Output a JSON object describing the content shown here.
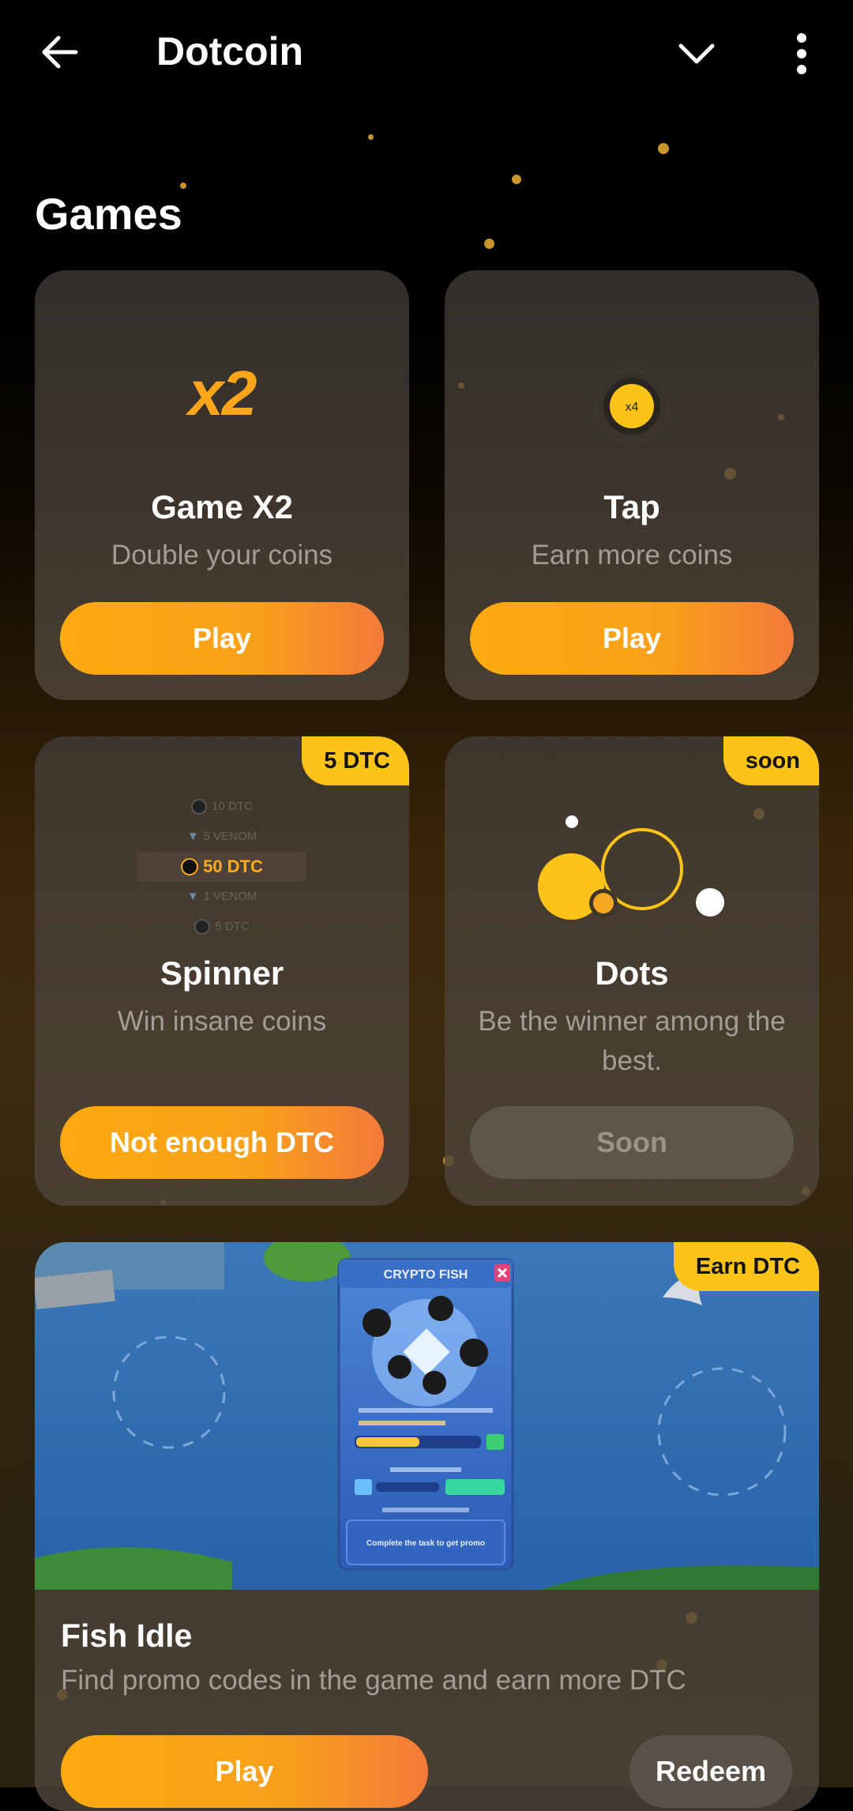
{
  "header": {
    "title": "Dotcoin"
  },
  "section": {
    "title": "Games"
  },
  "cards": [
    {
      "logo": "x2",
      "title": "Game X2",
      "subtitle": "Double your coins",
      "button": "Play"
    },
    {
      "logo": "x4",
      "title": "Tap",
      "subtitle": "Earn more coins",
      "button": "Play"
    },
    {
      "badge": "5 DTC",
      "title": "Spinner",
      "subtitle": "Win insane coins",
      "button": "Not enough DTC",
      "spinner_items": [
        "10 DTC",
        "5 VENOM",
        "50 DTC",
        "1 VENOM",
        "5 DTC"
      ]
    },
    {
      "badge": "soon",
      "title": "Dots",
      "subtitle": "Be the winner among the best.",
      "button": "Soon"
    }
  ],
  "fish": {
    "badge": "Earn DTC",
    "panel_title": "CRYPTO FISH",
    "panel_button": "Complete the task to get promo",
    "title": "Fish Idle",
    "subtitle": "Find promo codes in the game and earn more DTC",
    "play": "Play",
    "redeem": "Redeem"
  },
  "colors": {
    "accent": "#fdaa10",
    "badge": "#fcc419",
    "muted": "#a39d95"
  }
}
